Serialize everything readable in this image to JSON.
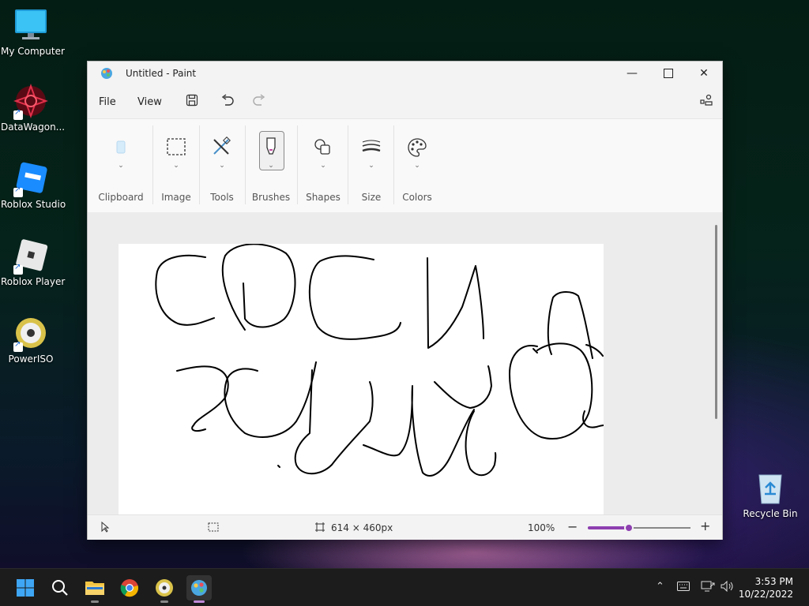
{
  "desktop": {
    "icons": [
      {
        "label": "My Computer",
        "icon": "monitor-icon"
      },
      {
        "label": "DataWagon...",
        "icon": "datawagon-icon"
      },
      {
        "label": "Roblox Studio",
        "icon": "roblox-studio-icon"
      },
      {
        "label": "Roblox Player",
        "icon": "roblox-player-icon"
      },
      {
        "label": "PowerISO",
        "icon": "poweriso-icon"
      },
      {
        "label": "Recycle Bin",
        "icon": "recycle-bin-icon"
      }
    ]
  },
  "window": {
    "title": "Untitled - Paint",
    "menu": {
      "file": "File",
      "view": "View"
    },
    "ribbon": {
      "groups": [
        "Clipboard",
        "Image",
        "Tools",
        "Brushes",
        "Shapes",
        "Size",
        "Colors"
      ]
    },
    "status": {
      "canvas_size": "614 × 460px",
      "zoom": "100%",
      "zoom_level": 0.4
    }
  },
  "taskbar": {
    "apps": [
      "start-icon",
      "search-icon",
      "file-explorer-icon",
      "chrome-icon",
      "poweriso-icon",
      "paint-icon"
    ],
    "clock": {
      "time": "3:53 PM",
      "date": "10/22/2022"
    }
  },
  "colors": {
    "accent": "#8e3fb0",
    "taskbar": "#1c1c1c"
  }
}
